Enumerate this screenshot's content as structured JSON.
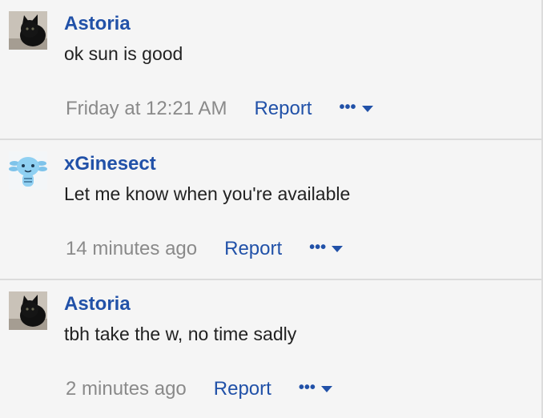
{
  "colors": {
    "link": "#2151a8",
    "muted": "#8a8a8a",
    "text": "#222222",
    "background": "#f5f5f5"
  },
  "comments": [
    {
      "author": "Astoria",
      "avatar_icon": "black-cat-avatar",
      "text": "ok sun is good",
      "time": "Friday at 12:21 AM",
      "report_label": "Report",
      "more_icon": "ellipsis-icon"
    },
    {
      "author": "xGinesect",
      "avatar_icon": "axolotl-avatar",
      "text": "Let me know when you're available",
      "time": "14 minutes ago",
      "report_label": "Report",
      "more_icon": "ellipsis-icon"
    },
    {
      "author": "Astoria",
      "avatar_icon": "black-cat-avatar",
      "text": "tbh take the w, no time sadly",
      "time": "2 minutes ago",
      "report_label": "Report",
      "more_icon": "ellipsis-icon"
    }
  ]
}
